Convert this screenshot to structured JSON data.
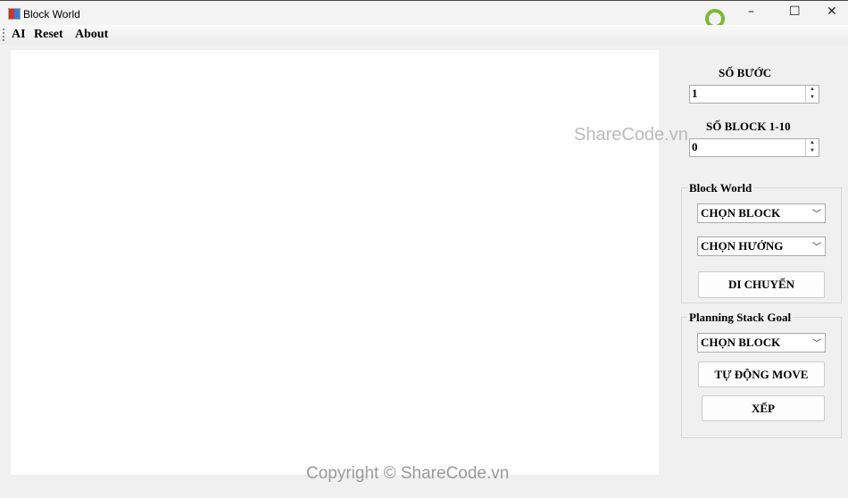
{
  "window": {
    "title": "Block World",
    "minimize": "–",
    "maximize": "☐",
    "close": "✕"
  },
  "menu": [
    "AI",
    "Reset",
    "About"
  ],
  "steps": {
    "label": "SỐ BƯỚC",
    "value": "1"
  },
  "blocks": {
    "label": "SỐ BLOCK 1-10",
    "value": "0"
  },
  "block_world": {
    "title": "Block World",
    "choose_block": "CHỌN BLOCK",
    "choose_direction": "CHỌN HƯỚNG",
    "move": "DI CHUYỂN"
  },
  "planning": {
    "title": "Planning Stack Goal",
    "choose_block": "CHỌN BLOCK",
    "auto_move": "TỰ ĐỘNG MOVE",
    "stack": "XẾP"
  },
  "watermark": {
    "logo_a": "SHARE",
    "logo_b": "CODE.vn",
    "mid": "ShareCode.vn",
    "bottom": "Copyright © ShareCode.vn"
  },
  "colors": {
    "accent": "#7cb833"
  }
}
